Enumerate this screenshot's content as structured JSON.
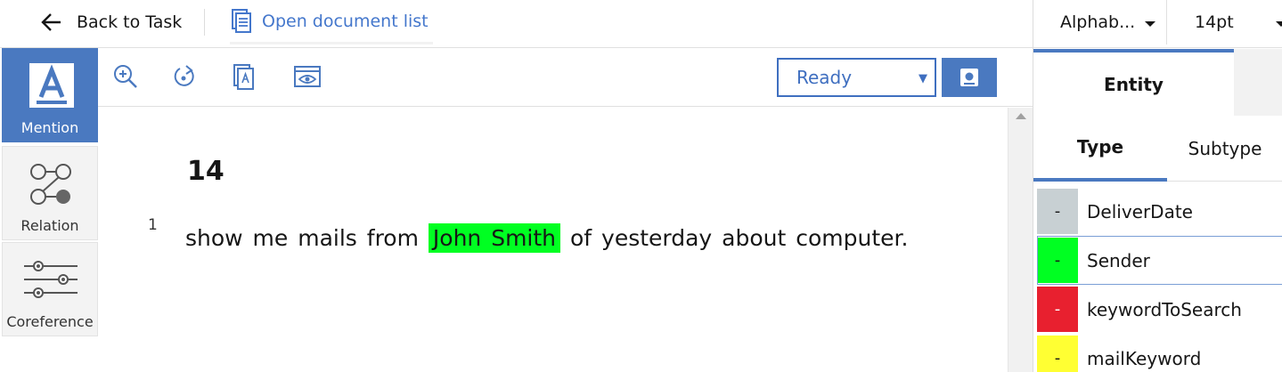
{
  "header": {
    "back_label": "Back to Task",
    "open_docs_label": "Open document list"
  },
  "tools": [
    {
      "label": "Mention",
      "icon": "mention-icon",
      "active": true
    },
    {
      "label": "Relation",
      "icon": "relation-icon",
      "active": false
    },
    {
      "label": "Coreference",
      "icon": "coreference-icon",
      "active": false
    }
  ],
  "toolbar": {
    "icons": [
      "zoom-in-icon",
      "rotate-icon",
      "document-icon",
      "view-icon"
    ],
    "status_value": "Ready",
    "save_icon": "save-icon"
  },
  "document": {
    "title": "14",
    "lines": [
      {
        "number": "1",
        "before": "show me mails from ",
        "mention": "John Smith",
        "after": " of yesterday about computer."
      }
    ]
  },
  "right_panel": {
    "sort_value": "Alphab...",
    "font_size_value": "14pt",
    "tab_entity": "Entity",
    "subtab_type": "Type",
    "subtab_subtype": "Subtype",
    "entity_types": [
      {
        "name": "DeliverDate",
        "swatch_label": "-",
        "color": "#c8d0d3",
        "selected": false
      },
      {
        "name": "Sender",
        "swatch_label": "-",
        "color": "#00ff22",
        "selected": true
      },
      {
        "name": "keywordToSearch",
        "swatch_label": "-",
        "color": "#e8202f",
        "selected": false
      },
      {
        "name": "mailKeyword",
        "swatch_label": "-",
        "color": "#ffff33",
        "selected": false
      }
    ]
  },
  "colors": {
    "accent": "#4a79c0",
    "link": "#4477cc",
    "mention_highlight": "#00ff22"
  }
}
